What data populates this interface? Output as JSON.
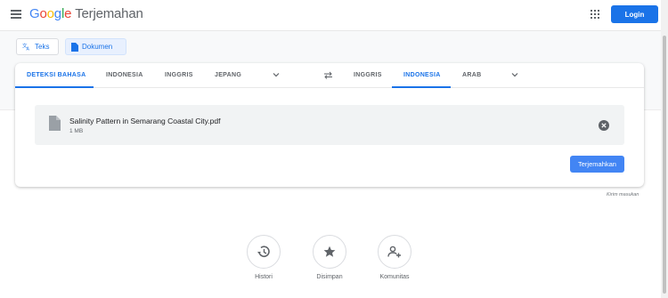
{
  "header": {
    "logo_google": [
      "G",
      "o",
      "o",
      "g",
      "l",
      "e"
    ],
    "product": "Terjemahan",
    "login_label": "Login"
  },
  "modes": {
    "text_label": "Teks",
    "document_label": "Dokumen"
  },
  "source_langs": [
    "DETEKSI BAHASA",
    "INDONESIA",
    "INGGRIS",
    "JEPANG"
  ],
  "target_langs": [
    "INGGRIS",
    "INDONESIA",
    "ARAB"
  ],
  "file": {
    "name": "Salinity Pattern in Semarang Coastal City.pdf",
    "size": "1 MB"
  },
  "translate_label": "Terjemahkan",
  "feedback_label": "Kirim masukan",
  "shortcuts": [
    {
      "label": "Histori",
      "icon": "history-icon"
    },
    {
      "label": "Disimpan",
      "icon": "star-icon"
    },
    {
      "label": "Komunitas",
      "icon": "community-icon"
    }
  ],
  "colors": {
    "accent": "#1a73e8",
    "button": "#4285f4"
  }
}
